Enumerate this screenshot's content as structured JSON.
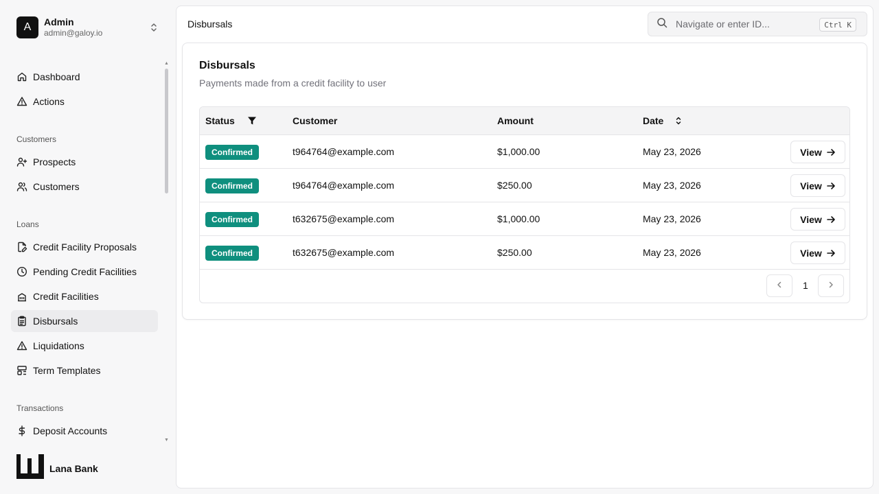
{
  "user": {
    "initial": "A",
    "name": "Admin",
    "email": "admin@galoy.io"
  },
  "sidebar": {
    "items_top": [
      {
        "label": "Dashboard",
        "icon": "home-icon"
      },
      {
        "label": "Actions",
        "icon": "alert-triangle-icon"
      }
    ],
    "group_customers": "Customers",
    "items_customers": [
      {
        "label": "Prospects",
        "icon": "user-plus-icon"
      },
      {
        "label": "Customers",
        "icon": "users-icon"
      }
    ],
    "group_loans": "Loans",
    "items_loans": [
      {
        "label": "Credit Facility Proposals",
        "icon": "file-edit-icon"
      },
      {
        "label": "Pending Credit Facilities",
        "icon": "clock-icon"
      },
      {
        "label": "Credit Facilities",
        "icon": "building-icon"
      },
      {
        "label": "Disbursals",
        "icon": "clipboard-icon",
        "active": true
      },
      {
        "label": "Liquidations",
        "icon": "alert-triangle-icon"
      },
      {
        "label": "Term Templates",
        "icon": "layout-template-icon"
      }
    ],
    "group_transactions": "Transactions",
    "items_transactions": [
      {
        "label": "Deposit Accounts",
        "icon": "dollar-icon"
      }
    ]
  },
  "brand": {
    "name": "Lana Bank"
  },
  "topbar": {
    "title": "Disbursals",
    "search_placeholder": "Navigate or enter ID...",
    "shortcut": "Ctrl K"
  },
  "card": {
    "title": "Disbursals",
    "subtitle": "Payments made from a credit facility to user"
  },
  "table": {
    "headers": {
      "status": "Status",
      "customer": "Customer",
      "amount": "Amount",
      "date": "Date"
    },
    "rows": [
      {
        "status": "Confirmed",
        "customer": "t964764@example.com",
        "amount": "$1,000.00",
        "date": "May 23, 2026",
        "action": "View"
      },
      {
        "status": "Confirmed",
        "customer": "t964764@example.com",
        "amount": "$250.00",
        "date": "May 23, 2026",
        "action": "View"
      },
      {
        "status": "Confirmed",
        "customer": "t632675@example.com",
        "amount": "$1,000.00",
        "date": "May 23, 2026",
        "action": "View"
      },
      {
        "status": "Confirmed",
        "customer": "t632675@example.com",
        "amount": "$250.00",
        "date": "May 23, 2026",
        "action": "View"
      }
    ],
    "page": "1"
  },
  "colors": {
    "confirmed_badge": "#0f8f7e",
    "active_nav": "#ececee"
  }
}
